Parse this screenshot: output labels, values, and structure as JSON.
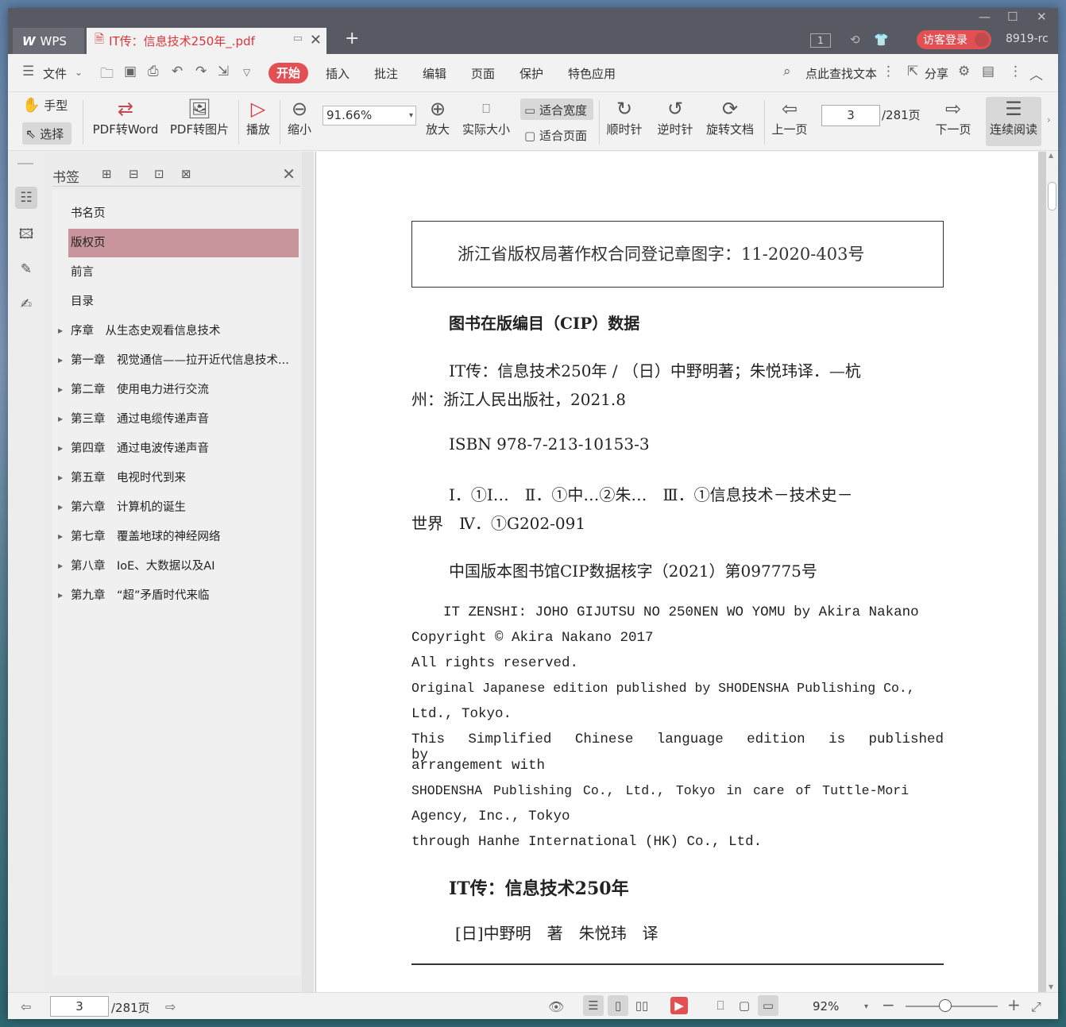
{
  "titlebar": {
    "app_name": "WPS",
    "doc_tab_title": "IT传：信息技术250年_.pdf",
    "visitor_login": "访客登录",
    "user_code": "8919-rc",
    "window_count": "1"
  },
  "menu": {
    "file": "文件",
    "tabs": [
      "开始",
      "插入",
      "批注",
      "编辑",
      "页面",
      "保护",
      "特色应用"
    ],
    "search": "点此查找文本",
    "share": "分享"
  },
  "toolbar": {
    "hand": "手型",
    "select": "选择",
    "pdf_to_word": "PDF转Word",
    "pdf_to_image": "PDF转图片",
    "play": "播放",
    "zoom_out": "缩小",
    "zoom_value": "91.66%",
    "zoom_in": "放大",
    "actual_size": "实际大小",
    "fit_width": "适合宽度",
    "fit_page": "适合页面",
    "rotate_cw": "顺时针",
    "rotate_ccw": "逆时针",
    "rotate_doc": "旋转文档",
    "prev_page": "上一页",
    "page_value": "3",
    "page_total": "/281页",
    "next_page": "下一页",
    "continuous": "连续阅读"
  },
  "sidebar": {
    "title": "书签",
    "bookmarks": [
      {
        "label": "书名页"
      },
      {
        "label": "版权页"
      },
      {
        "label": "前言"
      },
      {
        "label": "目录"
      },
      {
        "label": "序章　从生态史观看信息技术"
      },
      {
        "label": "第一章　视觉通信——拉开近代信息技术..."
      },
      {
        "label": "第二章　使用电力进行交流"
      },
      {
        "label": "第三章　通过电缆传递声音"
      },
      {
        "label": "第四章　通过电波传递声音"
      },
      {
        "label": "第五章　电视时代到来"
      },
      {
        "label": "第六章　计算机的诞生"
      },
      {
        "label": "第七章　覆盖地球的神经网络"
      },
      {
        "label": "第八章　IoE、大数据以及AI"
      },
      {
        "label": "第九章　“超”矛盾时代来临"
      }
    ]
  },
  "page": {
    "copyright_box": "浙江省版权局著作权合同登记章图字：11-2020-403号",
    "cip_title": "图书在版编目（CIP）数据",
    "cip_line1": "IT传：信息技术250年 / （日）中野明著；朱悦玮译．—杭",
    "cip_line2": "州：浙江人民出版社，2021.8",
    "isbn": "ISBN 978-7-213-10153-3",
    "class_line1": "Ⅰ．①I…　Ⅱ．①中…②朱…　Ⅲ．①信息技术－技术史－",
    "class_line2": "世界　Ⅳ．①G202-091",
    "cip_number": "中国版本图书馆CIP数据核字（2021）第097775号",
    "en_lines": [
      "IT ZENSHI: JOHO GIJUTSU NO 250NEN WO YOMU by Akira Nakano",
      "Copyright © Akira Nakano 2017",
      "All rights reserved.",
      "Original Japanese edition published by SHODENSHA Publishing Co.,",
      "Ltd., Tokyo.",
      "This Simplified Chinese language edition is published by",
      "arrangement with",
      "SHODENSHA Publishing Co., Ltd., Tokyo in care of Tuttle-Mori",
      "Agency, Inc., Tokyo",
      "through Hanhe International (HK) Co., Ltd."
    ],
    "book_title": "IT传：信息技术250年",
    "authors": "[日]中野明　著　朱悦玮　译"
  },
  "statusbar": {
    "page_value": "3",
    "page_total": "/281页",
    "zoom": "92%"
  },
  "colors": {
    "accent": "#e35054",
    "selected_bookmark": "#c9959c"
  }
}
